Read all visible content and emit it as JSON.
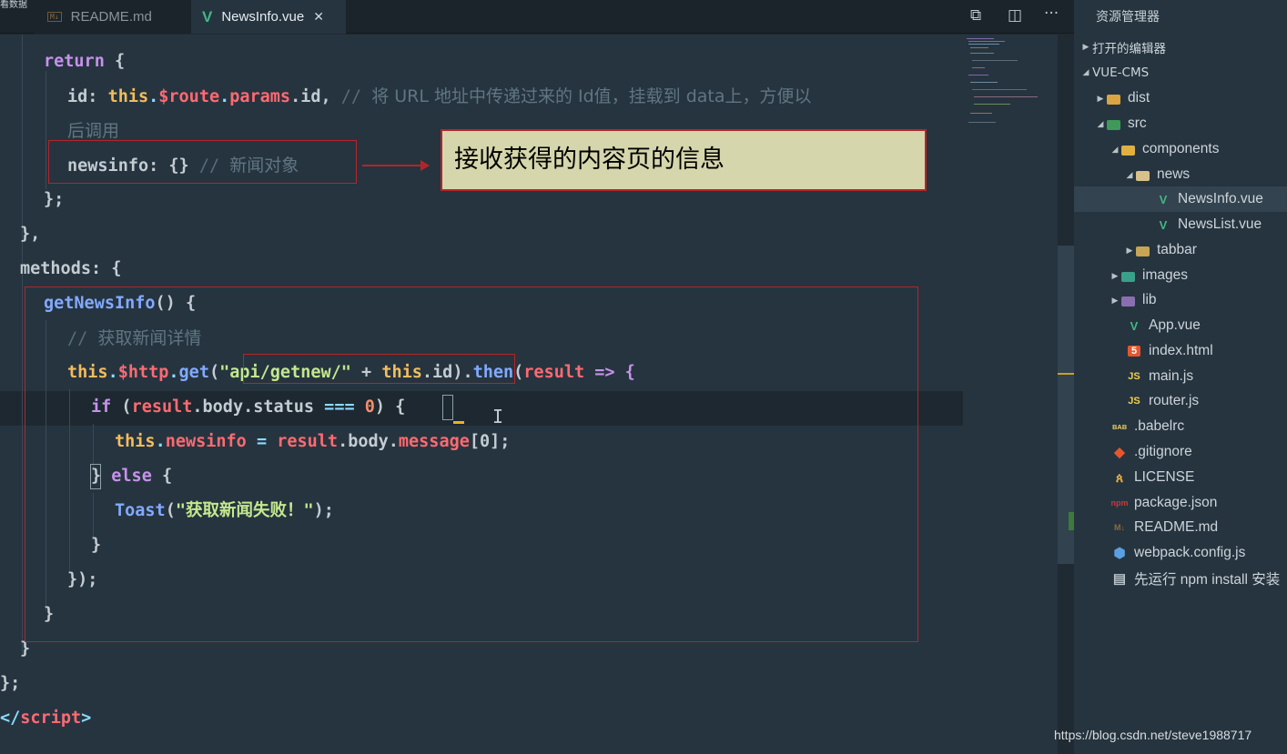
{
  "corner_label": "看数据",
  "tabs": [
    {
      "label": "README.md",
      "badge": "M↓",
      "active": false
    },
    {
      "label": "NewsInfo.vue",
      "active": true
    }
  ],
  "explorer": {
    "title": "资源管理器",
    "sections": {
      "open_editors": "打开的编辑器",
      "project": "VUE-CMS"
    },
    "items": [
      {
        "label": "dist",
        "icon": "folder-dist-icon"
      },
      {
        "label": "src",
        "icon": "folder-src-icon"
      },
      {
        "label": "components",
        "icon": "folder-components-icon"
      },
      {
        "label": "news",
        "icon": "folder-news-icon"
      },
      {
        "label": "NewsInfo.vue",
        "icon": "vue-icon",
        "selected": true
      },
      {
        "label": "NewsList.vue",
        "icon": "vue-icon"
      },
      {
        "label": "tabbar",
        "icon": "folder-icon"
      },
      {
        "label": "images",
        "icon": "folder-images-icon"
      },
      {
        "label": "lib",
        "icon": "folder-lib-icon"
      },
      {
        "label": "App.vue",
        "icon": "vue-icon"
      },
      {
        "label": "index.html",
        "icon": "html5-icon"
      },
      {
        "label": "main.js",
        "icon": "js-icon"
      },
      {
        "label": "router.js",
        "icon": "js-icon"
      },
      {
        "label": ".babelrc",
        "icon": "babel-icon"
      },
      {
        "label": ".gitignore",
        "icon": "git-icon"
      },
      {
        "label": "LICENSE",
        "icon": "license-icon"
      },
      {
        "label": "package.json",
        "icon": "npm-icon"
      },
      {
        "label": "README.md",
        "icon": "markdown-icon"
      },
      {
        "label": "webpack.config.js",
        "icon": "webpack-icon"
      },
      {
        "label": "先运行 npm install 安装",
        "icon": "file-icon"
      }
    ]
  },
  "callout_text": "接收获得的内容页的信息",
  "watermark": "https://blog.csdn.net/steve1988717",
  "code": {
    "l1": {
      "t1": "return",
      "t2": " {"
    },
    "l2": {
      "t1": "id",
      "t2": ": ",
      "t3": "this",
      "t4": ".",
      "t5": "$route",
      "t6": ".",
      "t7": "params",
      "t8": ".id, ",
      "t9": "// ",
      "t10": "将 URL 地址中传递过来的 Id值，挂载到 data上，方便以"
    },
    "l3": {
      "t1": "后调用"
    },
    "l4": {
      "t1": "newsinfo",
      "t2": ": {} ",
      "t3": "// ",
      "t4": "新闻对象"
    },
    "l5": {
      "t1": "};"
    },
    "l6": {
      "t1": "},"
    },
    "l7": {
      "t1": "methods",
      "t2": ": {"
    },
    "l8": {
      "t1": "getNewsInfo",
      "t2": "() {"
    },
    "l9": {
      "t1": "// ",
      "t2": "获取新闻详情"
    },
    "l10": {
      "t1": "this",
      "t2": ".",
      "t3": "$http",
      "t4": ".",
      "t5": "get",
      "t6": "(",
      "t7": "\"api/getnew/\"",
      "t8": " + ",
      "t9": "this",
      "t10": ".id",
      "t11": ").",
      "t12": "then",
      "t13": "(",
      "t14": "result",
      "t15": " => {"
    },
    "l11": {
      "t1": "if",
      "t2": " (",
      "t3": "result",
      "t4": ".body.status",
      "t5": " === ",
      "t6": "0",
      "t7": ") {"
    },
    "l12": {
      "t1": "this",
      "t2": ".",
      "t3": "newsinfo",
      "t4": " = ",
      "t5": "result",
      "t6": ".body.",
      "t7": "message",
      "t8": "[0];"
    },
    "l13": {
      "t1": "} ",
      "t2": "else",
      "t3": " {"
    },
    "l14": {
      "t1": "Toast",
      "t2": "(",
      "t3": "\"获取新闻失败！\"",
      "t4": ");"
    },
    "l15": {
      "t1": "}"
    },
    "l16": {
      "t1": "});"
    },
    "l17": {
      "t1": "}"
    },
    "l18": {
      "t1": "}"
    },
    "l19": {
      "t1": "};"
    },
    "l20": {
      "t1": "</",
      "t2": "script",
      "t3": ">"
    }
  }
}
